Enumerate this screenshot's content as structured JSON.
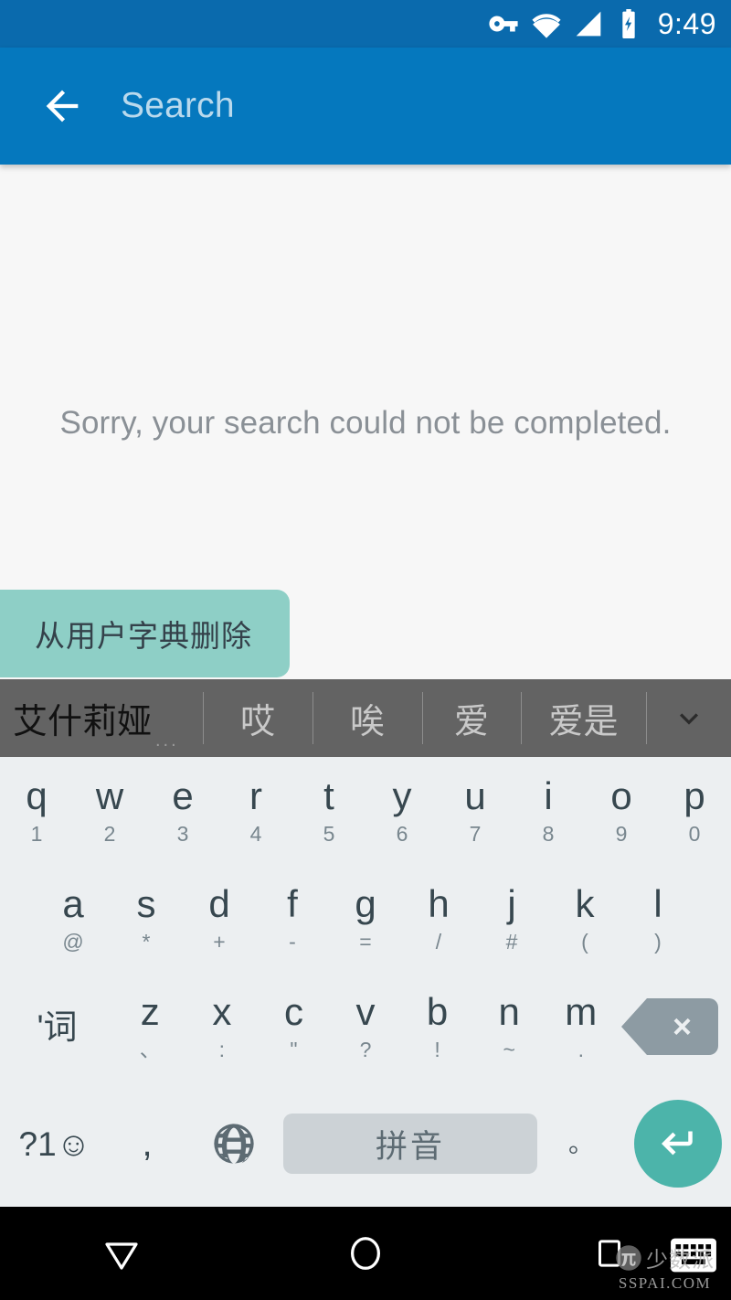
{
  "status_bar": {
    "time": "9:49",
    "icons": [
      "vpn-key-icon",
      "wifi-icon",
      "cellular-signal-icon",
      "battery-charging-icon"
    ],
    "background_color": "#0a6aad"
  },
  "app_bar": {
    "back_label": "back-arrow",
    "search_value": "",
    "search_placeholder": "Search",
    "background_color": "#0578be"
  },
  "content": {
    "empty_message": "Sorry, your search could not be completed.",
    "background_color": "#f7f7f7"
  },
  "chip": {
    "label": "从用户字典删除",
    "background_color": "#8ecfc6",
    "text_color": "#34414a"
  },
  "suggestion_strip": {
    "background_color": "#636363",
    "ellipsis": "...",
    "expand_icon": "chevron-down-icon",
    "items": [
      {
        "text": "艾什莉娅",
        "active": true
      },
      {
        "text": "哎",
        "active": false
      },
      {
        "text": "唉",
        "active": false
      },
      {
        "text": "爱",
        "active": false
      },
      {
        "text": "爱是",
        "active": false
      }
    ]
  },
  "keyboard": {
    "background_color": "#eceff1",
    "rows": [
      [
        {
          "main": "q",
          "hint": "1"
        },
        {
          "main": "w",
          "hint": "2"
        },
        {
          "main": "e",
          "hint": "3"
        },
        {
          "main": "r",
          "hint": "4"
        },
        {
          "main": "t",
          "hint": "5"
        },
        {
          "main": "y",
          "hint": "6"
        },
        {
          "main": "u",
          "hint": "7"
        },
        {
          "main": "i",
          "hint": "8"
        },
        {
          "main": "o",
          "hint": "9"
        },
        {
          "main": "p",
          "hint": "0"
        }
      ],
      [
        {
          "main": "a",
          "hint": "@"
        },
        {
          "main": "s",
          "hint": "*"
        },
        {
          "main": "d",
          "hint": "+"
        },
        {
          "main": "f",
          "hint": "-"
        },
        {
          "main": "g",
          "hint": "="
        },
        {
          "main": "h",
          "hint": "/"
        },
        {
          "main": "j",
          "hint": "#"
        },
        {
          "main": "k",
          "hint": "("
        },
        {
          "main": "l",
          "hint": ")"
        }
      ],
      [
        {
          "main": "'词",
          "hint": ""
        },
        {
          "main": "z",
          "hint": "、"
        },
        {
          "main": "x",
          "hint": ":"
        },
        {
          "main": "c",
          "hint": "\""
        },
        {
          "main": "v",
          "hint": "?"
        },
        {
          "main": "b",
          "hint": "!"
        },
        {
          "main": "n",
          "hint": "~"
        },
        {
          "main": "m",
          "hint": "."
        }
      ]
    ],
    "backspace_label": "×",
    "bottom_row": {
      "symbols_label": "?1☺",
      "comma_label": ",",
      "globe_label": "language-globe-icon",
      "space_label": "拼音",
      "period_label": "。",
      "enter_label": "enter-arrow-icon",
      "space_color": "#ccd2d6",
      "enter_color": "#4cb4aa",
      "backspace_color": "#8d9ba3"
    }
  },
  "nav_bar": {
    "background_color": "#000000",
    "buttons": [
      "back-triangle-icon",
      "home-circle-icon",
      "recents-square-icon"
    ],
    "keyboard_indicator": "keyboard-icon"
  },
  "watermark": {
    "cn_text": "少数派",
    "url_text": "SSPAI.COM",
    "logo": "pi-logo-icon"
  }
}
